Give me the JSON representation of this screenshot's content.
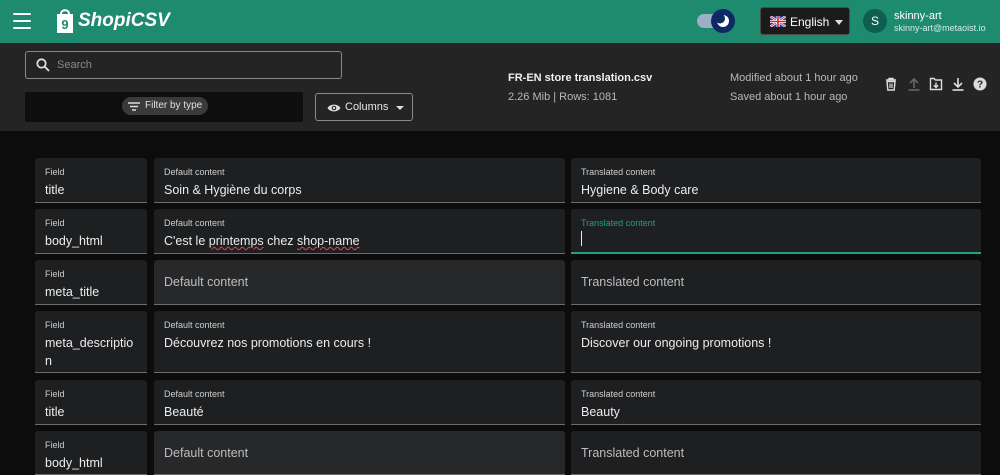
{
  "app": {
    "name": "ShopiCSV",
    "language": "English",
    "user": {
      "initial": "S",
      "name": "skinny-art",
      "email": "skinny-art@metaoist.io"
    }
  },
  "toolbar": {
    "search_placeholder": "Search",
    "filter_label": "Filter by type",
    "columns_label": "Columns",
    "file_name": "FR-EN store translation.csv",
    "file_meta": "2.26 Mib | Rows: 1081",
    "modified": "Modified about 1 hour ago",
    "saved": "Saved about 1 hour ago",
    "actions": [
      "trash-icon",
      "upload-icon",
      "save-icon",
      "download-icon",
      "help-icon"
    ]
  },
  "labels": {
    "field": "Field",
    "default": "Default content",
    "translated": "Translated content"
  },
  "rows": [
    {
      "field": "title",
      "default": "Soin & Hygiène du corps",
      "translated": "Hygiene & Body care"
    },
    {
      "field": "body_html",
      "default_pre": "C'est le ",
      "default_spell1": "printemps",
      "default_mid": " chez ",
      "default_spell2": "shop-name",
      "translated": ""
    },
    {
      "field": "meta_title",
      "default": "",
      "translated": ""
    },
    {
      "field": "meta_description",
      "field_line1": "meta_descriptio",
      "field_line2": "n",
      "default": "Découvrez nos promotions en cours !",
      "translated": "Discover our ongoing promotions !"
    },
    {
      "field": "title",
      "default": "Beauté",
      "translated": "Beauty"
    },
    {
      "field": "body_html",
      "default": "",
      "translated": ""
    }
  ],
  "colors": {
    "appbar": "#1e8a6e",
    "accent": "#1fa37b",
    "background": "#0c0c0c"
  }
}
